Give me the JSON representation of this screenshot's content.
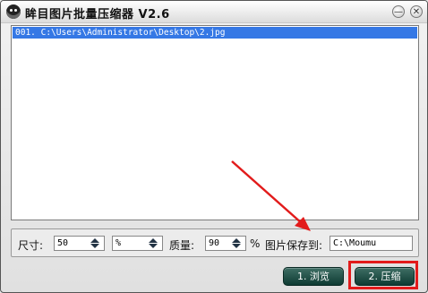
{
  "window": {
    "title": "眸目图片批量压缩器 V2.6",
    "min_glyph": "—",
    "close_glyph": "✕"
  },
  "file_list": {
    "items": [
      {
        "label": "001. C:\\Users\\Administrator\\Desktop\\2.jpg",
        "selected": true
      }
    ]
  },
  "settings": {
    "size_label": "尺寸:",
    "size_value": "50",
    "unit_value": "%",
    "quality_label": "质量:",
    "quality_value": "90",
    "quality_unit": "%",
    "save_label": "图片保存到:",
    "save_path": "C:\\Moumu"
  },
  "buttons": {
    "browse": "1. 浏览",
    "compress": "2. 压缩"
  },
  "colors": {
    "selection": "#3578e5",
    "button": "#0e3b33",
    "annotation": "#e21b1b"
  }
}
